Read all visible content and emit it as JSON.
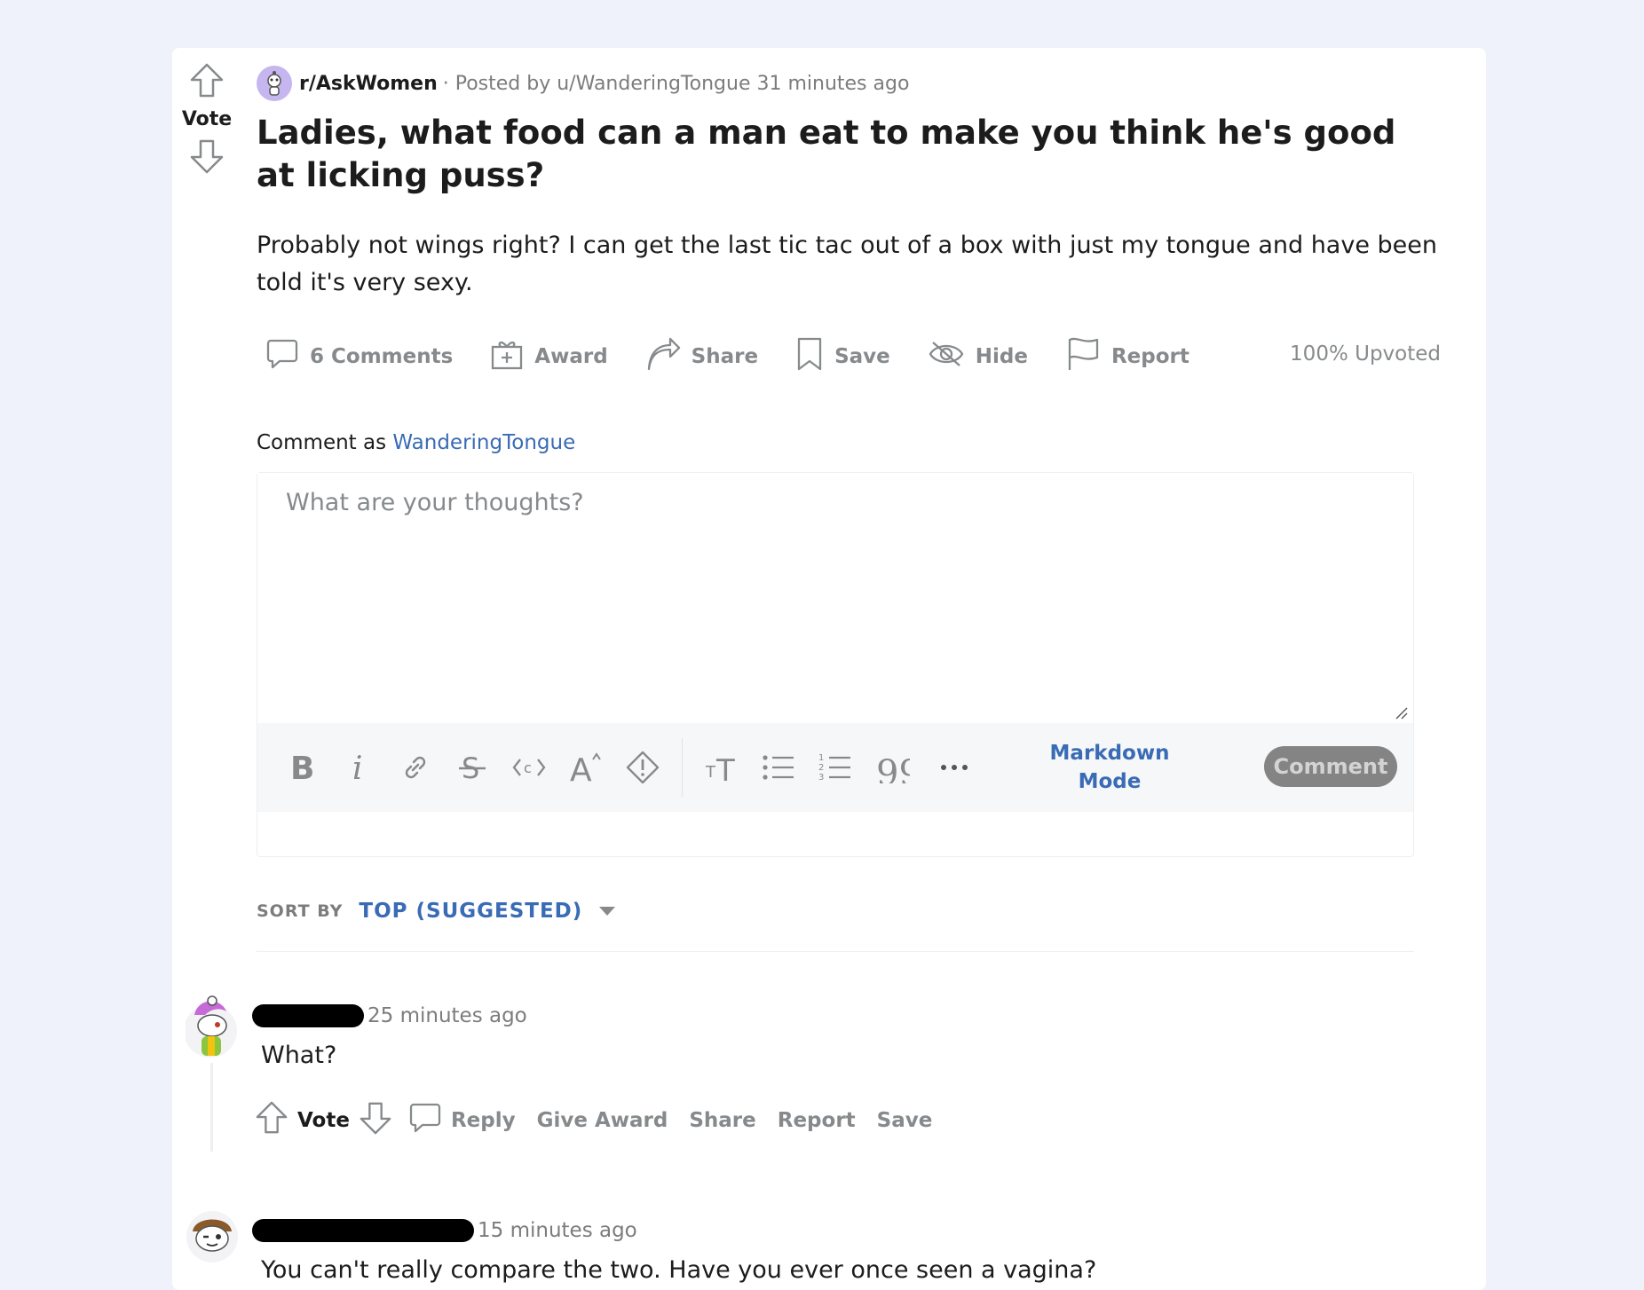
{
  "post": {
    "vote_label": "Vote",
    "subreddit": "r/AskWomen",
    "posted_by": "· Posted by u/WanderingTongue 31 minutes ago",
    "title": "Ladies, what food can a man eat to make you think he's good at licking puss?",
    "body": "Probably not wings right? I can get the last tic tac out of a box with just my tongue and have been told it's very sexy.",
    "actions": {
      "comments": "6 Comments",
      "award": "Award",
      "share": "Share",
      "save": "Save",
      "hide": "Hide",
      "report": "Report"
    },
    "upvoted": "100% Upvoted"
  },
  "composer": {
    "comment_as_label": "Comment as",
    "username": "WanderingTongue",
    "placeholder": "What are your thoughts?",
    "markdown_line1": "Markdown",
    "markdown_line2": "Mode",
    "submit_label": "Comment"
  },
  "sort": {
    "label": "SORT BY",
    "value": "TOP (SUGGESTED)"
  },
  "comments": [
    {
      "time": "25 minutes ago",
      "text": "What?",
      "vote_label": "Vote",
      "reply": "Reply",
      "give_award": "Give Award",
      "share": "Share",
      "report": "Report",
      "save": "Save"
    },
    {
      "time": "15 minutes ago",
      "text": "You can't really compare the two. Have you ever once seen a vagina?"
    }
  ],
  "colors": {
    "background": "#eff2fa",
    "link_blue": "#3a6bb5",
    "muted_gray": "#878a8c"
  }
}
